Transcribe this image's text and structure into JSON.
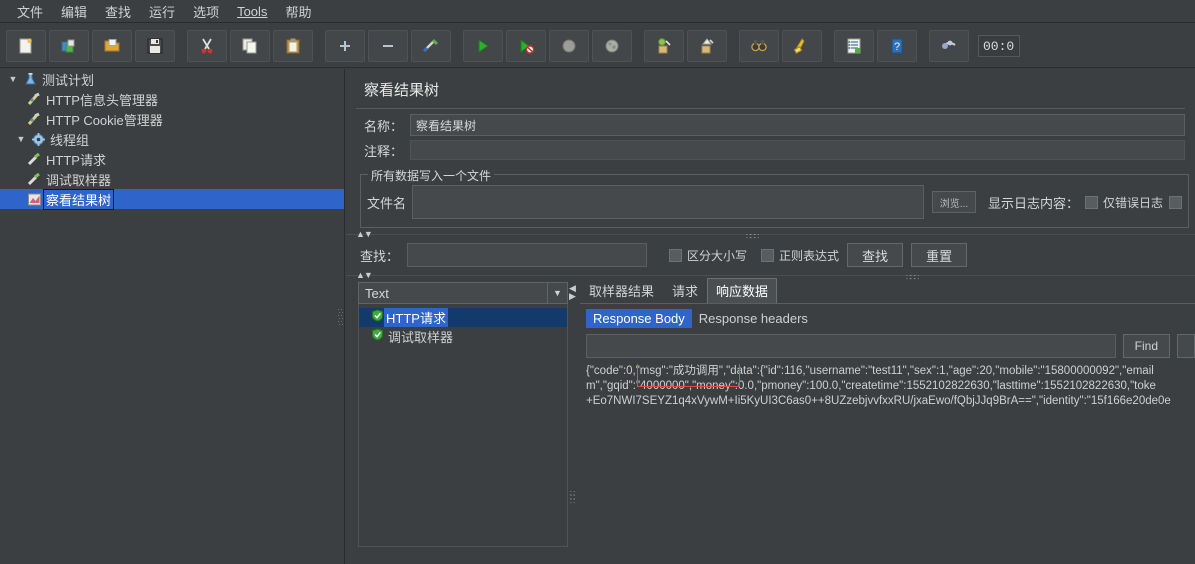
{
  "menubar": {
    "items": [
      {
        "label": "文件",
        "underlined": false
      },
      {
        "label": "编辑",
        "underlined": false
      },
      {
        "label": "查找",
        "underlined": false
      },
      {
        "label": "运行",
        "underlined": false
      },
      {
        "label": "选项",
        "underlined": false
      },
      {
        "label": "Tools",
        "underlined": true
      },
      {
        "label": "帮助",
        "underlined": false
      }
    ]
  },
  "toolbar": {
    "buttons": [
      {
        "name": "new-icon",
        "title": "新建"
      },
      {
        "name": "templates-icon",
        "title": "模板"
      },
      {
        "name": "open-icon",
        "title": "打开"
      },
      {
        "name": "save-icon",
        "title": "保存"
      },
      {
        "name": "cut-icon",
        "title": "剪切"
      },
      {
        "name": "copy-icon",
        "title": "复制"
      },
      {
        "name": "paste-icon",
        "title": "粘贴"
      },
      {
        "name": "expand-all-icon",
        "title": "展开全部"
      },
      {
        "name": "collapse-all-icon",
        "title": "收起全部"
      },
      {
        "name": "toggle-icon",
        "title": "启用/禁用"
      },
      {
        "name": "start-icon",
        "title": "启动"
      },
      {
        "name": "start-no-timers-icon",
        "title": "无间隔启动"
      },
      {
        "name": "stop-icon",
        "title": "停止"
      },
      {
        "name": "shutdown-icon",
        "title": "关闭"
      },
      {
        "name": "clear-icon",
        "title": "清除"
      },
      {
        "name": "clear-all-icon",
        "title": "清除全部"
      },
      {
        "name": "search-icon",
        "title": "搜索"
      },
      {
        "name": "search-reset-icon",
        "title": "重置搜索"
      },
      {
        "name": "function-helper-icon",
        "title": "函数助手对话框"
      },
      {
        "name": "help-icon",
        "title": "帮助"
      },
      {
        "name": "undo-icon",
        "title": "撤销"
      }
    ],
    "timer": "00:0"
  },
  "tree": {
    "nodes": [
      {
        "label": "测试计划",
        "icon": "test-plan-icon",
        "depth": 0,
        "toggle": "▼",
        "selected": false
      },
      {
        "label": "HTTP信息头管理器",
        "icon": "header-manager-icon",
        "depth": 1,
        "toggle": "",
        "selected": false
      },
      {
        "label": "HTTP Cookie管理器",
        "icon": "cookie-manager-icon",
        "depth": 1,
        "toggle": "",
        "selected": false
      },
      {
        "label": "线程组",
        "icon": "thread-group-icon",
        "depth": 0,
        "toggle": "▼",
        "selected": false
      },
      {
        "label": "HTTP请求",
        "icon": "http-request-icon",
        "depth": 1,
        "toggle": "",
        "selected": false
      },
      {
        "label": "调试取样器",
        "icon": "debug-sampler-icon",
        "depth": 1,
        "toggle": "",
        "selected": false
      },
      {
        "label": "察看结果树",
        "icon": "view-results-tree-icon",
        "depth": 1,
        "toggle": "",
        "selected": true
      }
    ]
  },
  "panel": {
    "title": "察看结果树",
    "name_label": "名称：",
    "name_value": "察看结果树",
    "comment_label": "注释：",
    "comment_value": "",
    "file_group": {
      "title": "所有数据写入一个文件",
      "filename_label": "文件名",
      "filename_value": "",
      "browse_label": "浏览...",
      "log_display_label": "显示日志内容：",
      "errors_only_label": "仅错误日志"
    },
    "search": {
      "label": "查找：",
      "value": "",
      "case_sensitive_label": "区分大小写",
      "regexp_label": "正则表达式",
      "find_label": "查找",
      "reset_label": "重置"
    },
    "renderer": {
      "selected": "Text"
    },
    "results": [
      {
        "label": "HTTP请求",
        "status": "success",
        "selected": true
      },
      {
        "label": "调试取样器",
        "status": "success",
        "selected": false
      }
    ],
    "tabs": [
      {
        "label": "取样器结果",
        "active": false
      },
      {
        "label": "请求",
        "active": false
      },
      {
        "label": "响应数据",
        "active": true
      }
    ],
    "subtabs": [
      {
        "label": "Response Body",
        "active": true
      },
      {
        "label": "Response headers",
        "active": false
      }
    ],
    "find": {
      "value": "",
      "button_label": "Find"
    },
    "response_body": {
      "lines": [
        "{\"code\":0,\"msg\":\"成功调用\",\"data\":{\"id\":116,\"username\":\"test11\",\"sex\":1,\"age\":20,\"mobile\":\"15800000092\",\"email",
        "m\",\"gqid\":\"4000000\",\"money\":0.0,\"pmoney\":100.0,\"createtime\":1552102822630,\"lasttime\":1552102822630,\"toke",
        "+Eo7NWI7SEYZ1q4xVywM+Ii5KyUI3C6as0++8UZzebjvvfxxRU/jxaEwo/fQbjJJq9BrA==\",\"identity\":\"15f166e20de0e"
      ],
      "highlight_text": "\"msg\":\"成功调用\""
    }
  },
  "colors": {
    "window_bg": "#3c3f41",
    "selection_blue": "#2f65ca",
    "text_primary": "#d2d2d2",
    "annotation_red": "#e34b4b",
    "border": "#5a5f62"
  }
}
